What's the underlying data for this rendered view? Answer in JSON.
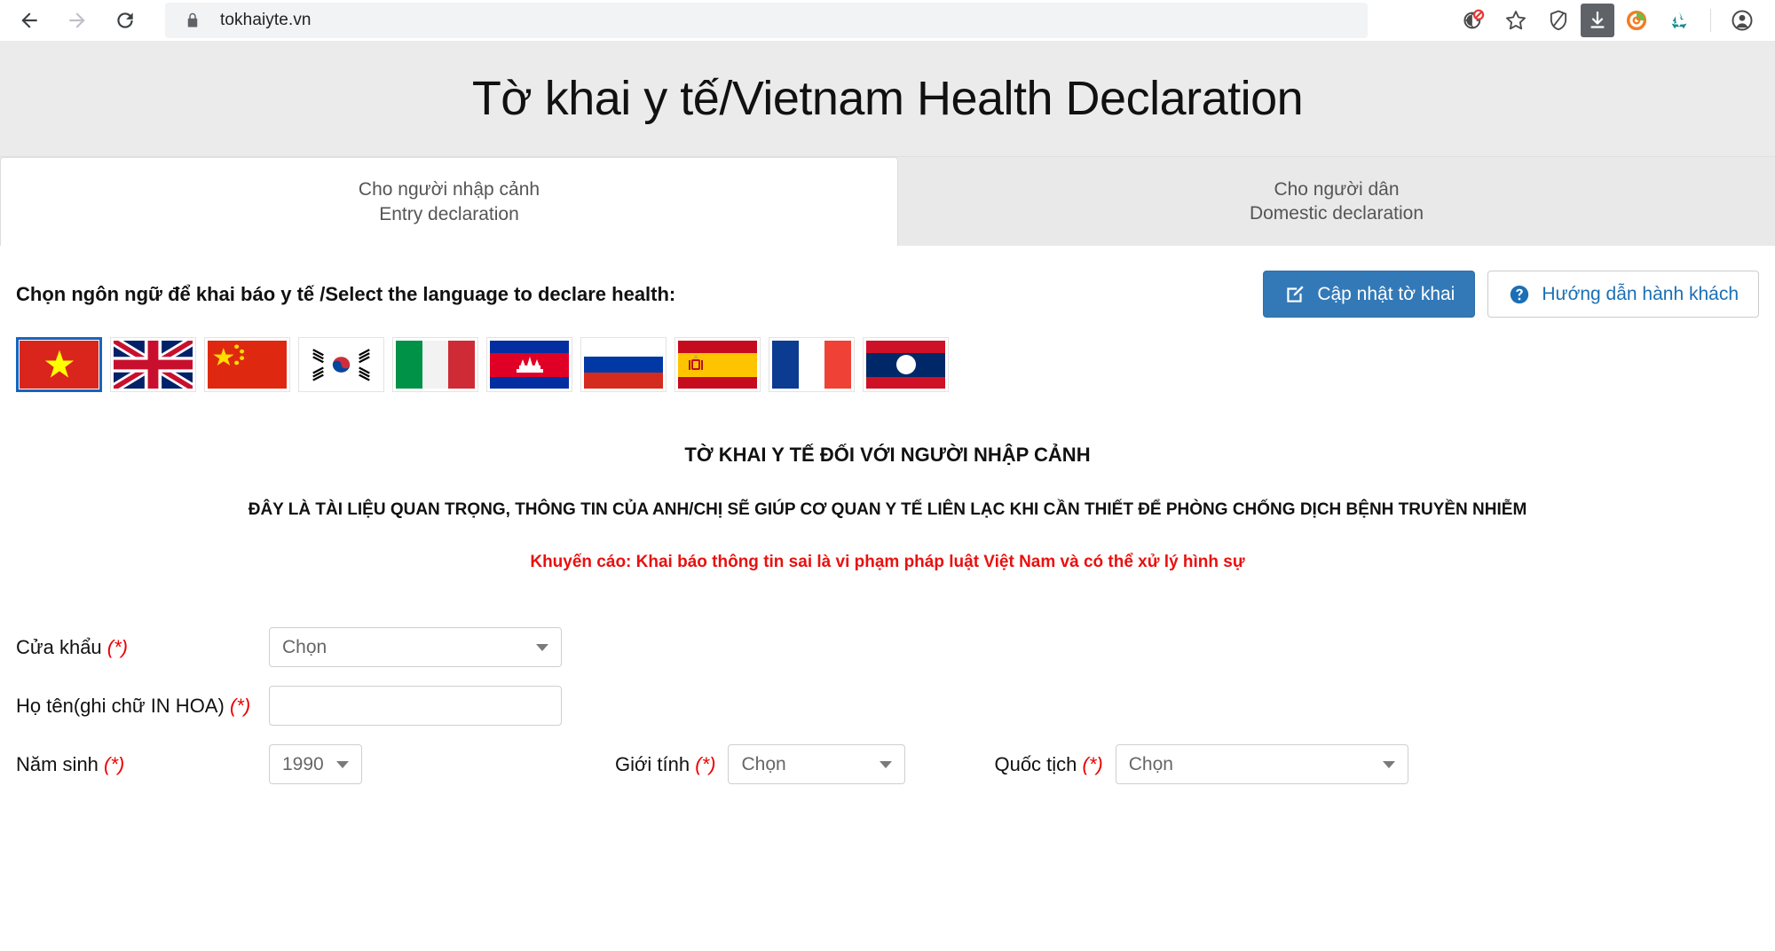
{
  "browser": {
    "back_icon": "arrow-left-icon",
    "forward_icon": "arrow-right-icon",
    "reload_icon": "reload-icon",
    "lock_icon": "lock-icon",
    "url": "tokhaiyte.vn",
    "toolbar_icons": [
      "tracker-blocked-icon",
      "bookmark-star-icon",
      "shield-icon",
      "download-icon",
      "extension-orange-icon",
      "recycle-icon",
      "profile-avatar-icon"
    ]
  },
  "header": {
    "title": "Tờ khai y tế/Vietnam Health Declaration"
  },
  "tabs": [
    {
      "line1": "Cho người nhập cảnh",
      "line2": "Entry declaration",
      "active": true
    },
    {
      "line1": "Cho người dân",
      "line2": "Domestic declaration",
      "active": false
    }
  ],
  "language_section": {
    "label": "Chọn ngôn ngữ để khai báo y tế /Select the language to declare health:",
    "flags": [
      {
        "name": "vietnam",
        "selected": true
      },
      {
        "name": "united-kingdom",
        "selected": false
      },
      {
        "name": "china",
        "selected": false
      },
      {
        "name": "south-korea",
        "selected": false
      },
      {
        "name": "italy",
        "selected": false
      },
      {
        "name": "cambodia",
        "selected": false
      },
      {
        "name": "russia",
        "selected": false
      },
      {
        "name": "spain",
        "selected": false
      },
      {
        "name": "france",
        "selected": false
      },
      {
        "name": "laos",
        "selected": false
      }
    ]
  },
  "actions": {
    "update_label": "Cập nhật tờ khai",
    "update_icon": "edit-square-icon",
    "guide_label": "Hướng dẫn hành khách",
    "guide_icon": "question-circle-icon",
    "primary_color": "#3379b7",
    "outline_text_color": "#1b6fb5"
  },
  "declaration": {
    "title": "TỜ KHAI Y TẾ ĐỐI VỚI NGƯỜI NHẬP CẢNH",
    "subtitle": "ĐÂY LÀ TÀI LIỆU QUAN TRỌNG, THÔNG TIN CỦA ANH/CHỊ SẼ GIÚP CƠ QUAN Y TẾ LIÊN LẠC KHI CẦN THIẾT ĐỂ PHÒNG CHỐNG DỊCH BỆNH TRUYỀN NHIỄM",
    "warning": "Khuyến cáo: Khai báo thông tin sai là vi phạm pháp luật Việt Nam và có thể xử lý hình sự",
    "warning_color": "#e8110f"
  },
  "form": {
    "required_mark": "(*)",
    "border_gate": {
      "label": "Cửa khẩu",
      "value": "Chọn"
    },
    "full_name": {
      "label": "Họ tên(ghi chữ IN HOA)",
      "value": "",
      "placeholder": ""
    },
    "birth_year": {
      "label": "Năm sinh",
      "value": "1990"
    },
    "gender": {
      "label": "Giới tính",
      "value": "Chọn"
    },
    "nationality": {
      "label": "Quốc tịch",
      "value": "Chọn"
    }
  }
}
